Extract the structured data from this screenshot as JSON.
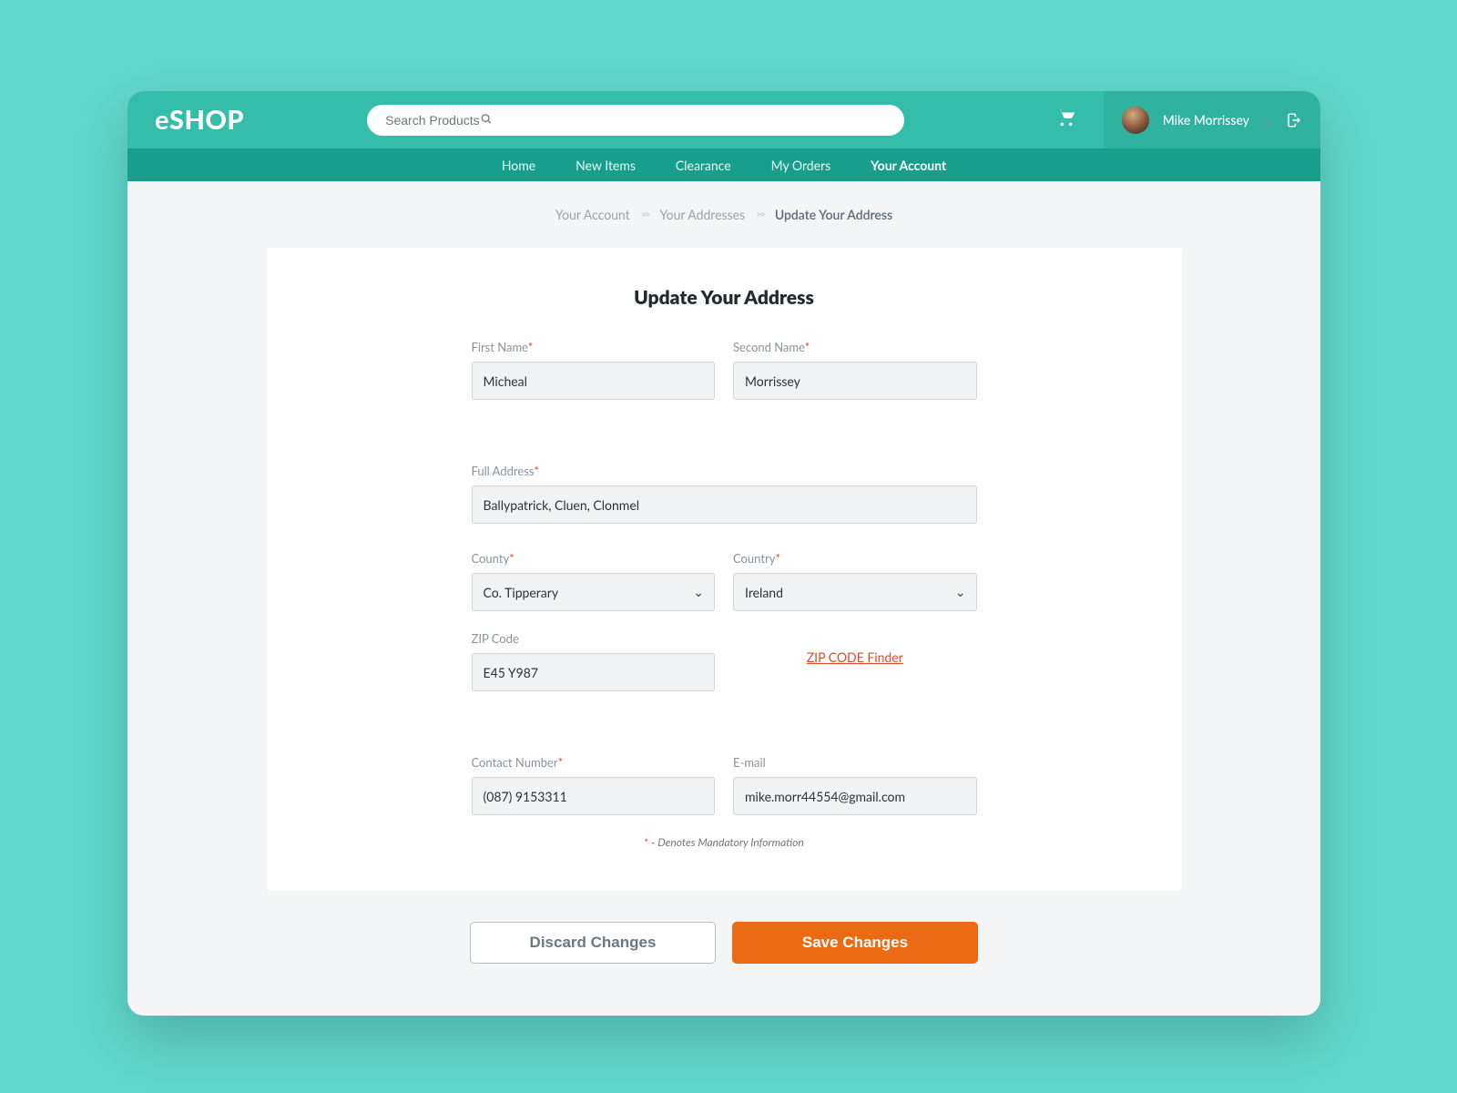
{
  "header": {
    "logo_e": "e",
    "logo_shop": "SHOP",
    "search_placeholder": "Search Products",
    "user_name": "Mike Morrissey"
  },
  "nav": {
    "items": [
      "Home",
      "New Items",
      "Clearance",
      "My Orders",
      "Your Account"
    ],
    "active_index": 4
  },
  "breadcrumb": {
    "items": [
      "Your Account",
      "Your Addresses",
      "Update Your Address"
    ]
  },
  "form": {
    "title": "Update Your Address",
    "first_name": {
      "label": "First Name",
      "required": true,
      "value": "Micheal"
    },
    "second_name": {
      "label": "Second Name",
      "required": true,
      "value": "Morrissey"
    },
    "full_address": {
      "label": "Full Address",
      "required": true,
      "value": "Ballypatrick, Cluen, Clonmel"
    },
    "county": {
      "label": "County",
      "required": true,
      "value": "Co. Tipperary"
    },
    "country": {
      "label": "Country",
      "required": true,
      "value": "Ireland"
    },
    "zip": {
      "label": "ZIP Code",
      "required": false,
      "value": "E45 Y987",
      "finder_label": "ZIP CODE Finder"
    },
    "contact": {
      "label": "Contact Number",
      "required": true,
      "value": "(087) 9153311"
    },
    "email": {
      "label": "E-mail",
      "required": false,
      "value": "mike.morr44554@gmail.com"
    },
    "mandatory_note": " - Denotes Mandatory Information",
    "mandatory_mark": "*"
  },
  "actions": {
    "discard": "Discard Changes",
    "save": "Save Changes"
  }
}
